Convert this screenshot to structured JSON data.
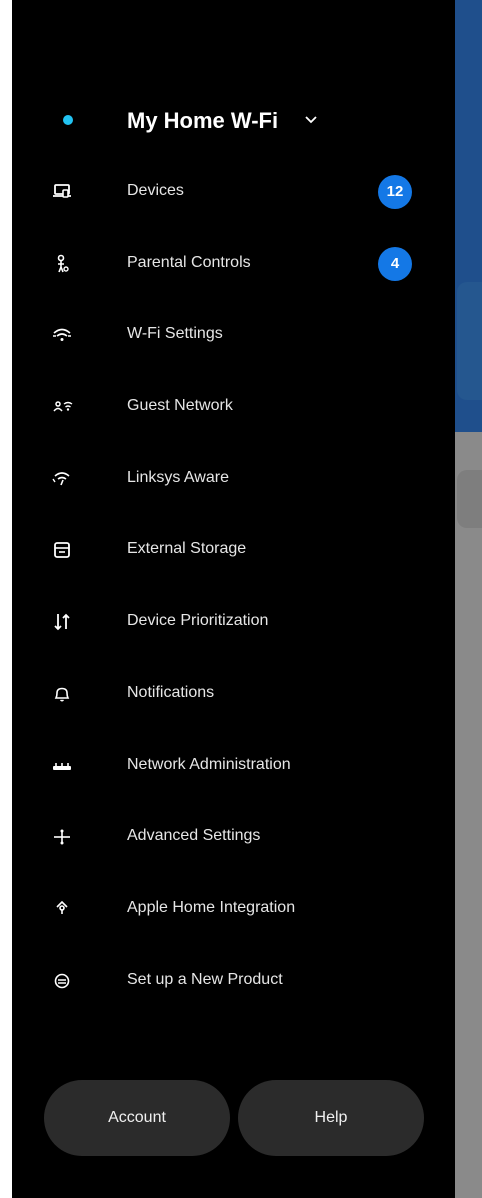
{
  "drawer": {
    "network": {
      "name": "My Home W-Fi",
      "status_color": "#22c3f2",
      "dropdown_icon": "chevron-down-icon"
    },
    "items": [
      {
        "label": "Devices",
        "icon": "devices-icon",
        "badge": "12"
      },
      {
        "label": "Parental Controls",
        "icon": "parental-controls-icon",
        "badge": "4"
      },
      {
        "label": "W-Fi Settings",
        "icon": "wifi-icon"
      },
      {
        "label": "Guest Network",
        "icon": "guest-network-icon"
      },
      {
        "label": "Linksys Aware",
        "icon": "aware-icon"
      },
      {
        "label": "External Storage",
        "icon": "storage-icon"
      },
      {
        "label": "Device Prioritization",
        "icon": "prioritization-icon"
      },
      {
        "label": "Notifications",
        "icon": "bell-icon"
      },
      {
        "label": "Network Administration",
        "icon": "router-icon"
      },
      {
        "label": "Advanced Settings",
        "icon": "sliders-icon"
      },
      {
        "label": "Apple Home Integration",
        "icon": "home-integration-icon"
      },
      {
        "label": "Set up a New Product",
        "icon": "setup-icon"
      }
    ],
    "buttons": {
      "account": "Account",
      "help": "Help"
    },
    "badge_color": "#1478e6"
  }
}
